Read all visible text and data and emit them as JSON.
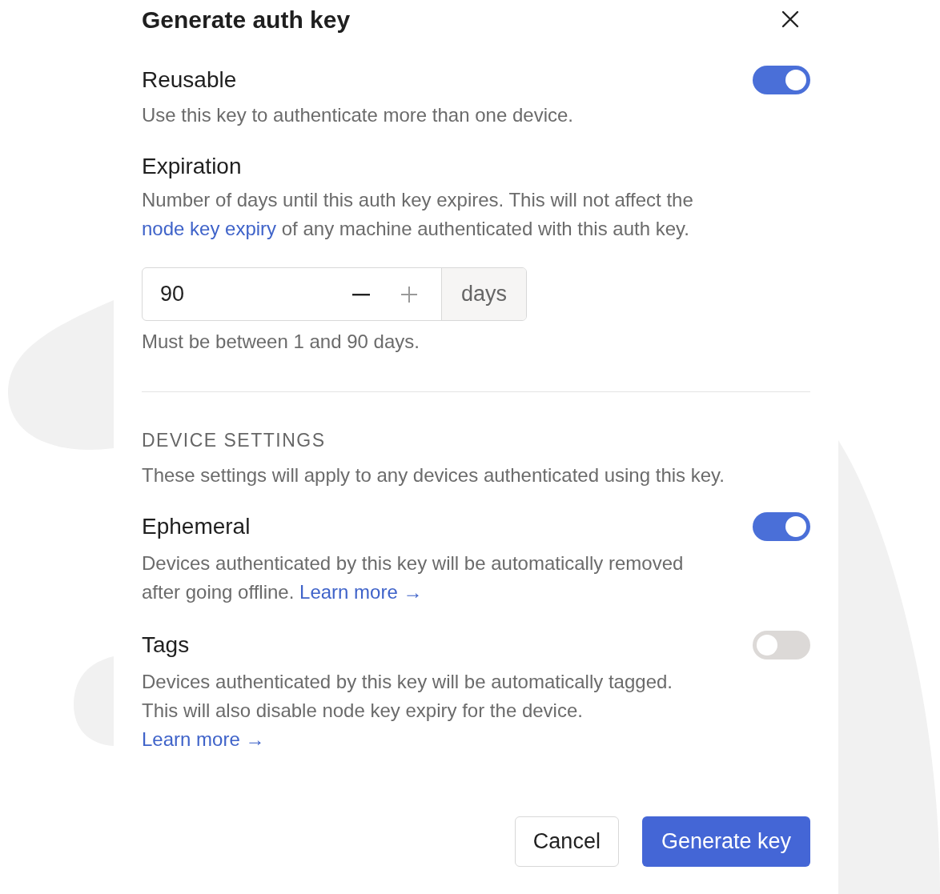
{
  "dialog": {
    "title": "Generate auth key"
  },
  "reusable": {
    "label": "Reusable",
    "on": true,
    "description": "Use this key to authenticate more than one device."
  },
  "expiration": {
    "label": "Expiration",
    "description": "Number of days until this auth key expires. This will not affect the ",
    "link": "node key expiry",
    "description_end": " of any machine authenticated with this auth key.",
    "value": "90",
    "unit": "days",
    "hint": "Must be between 1 and 90 days."
  },
  "device_settings": {
    "heading": "DEVICE SETTINGS",
    "description": "These settings will apply to any devices authenticated using this key."
  },
  "settings": [
    {
      "label": "Ephemeral",
      "on": true,
      "description": "Devices authenticated by this key will be automatically removed after going offline. ",
      "link": "Learn more →"
    },
    {
      "label": "Tags",
      "on": false,
      "description": "Devices authenticated by this key will be automatically tagged. This will also disable node key expiry for the device. ",
      "link": "Learn more →"
    }
  ],
  "buttons": [
    {
      "label": "Cancel",
      "kind": "secondary"
    },
    {
      "label": "Generate key",
      "kind": "primary"
    }
  ]
}
